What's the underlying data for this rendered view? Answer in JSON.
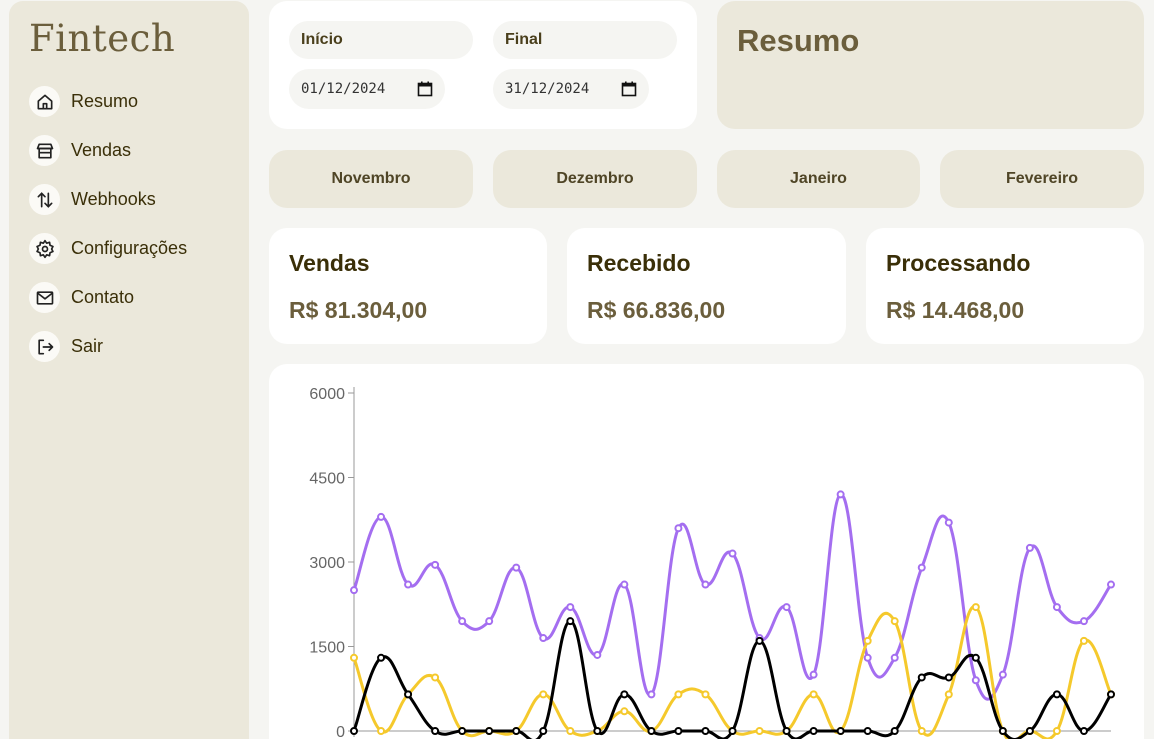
{
  "brand": {
    "name": "Fintech"
  },
  "sidebar": {
    "items": [
      {
        "label": "Resumo",
        "icon": "home-icon"
      },
      {
        "label": "Vendas",
        "icon": "store-icon"
      },
      {
        "label": "Webhooks",
        "icon": "arrows-updown-icon"
      },
      {
        "label": "Configurações",
        "icon": "gear-icon"
      },
      {
        "label": "Contato",
        "icon": "mail-icon"
      },
      {
        "label": "Sair",
        "icon": "logout-icon"
      }
    ]
  },
  "date_filter": {
    "start_label": "Início",
    "start_value": "01/12/2024",
    "end_label": "Final",
    "end_value": "31/12/2024"
  },
  "summary": {
    "title": "Resumo"
  },
  "months": [
    "Novembro",
    "Dezembro",
    "Janeiro",
    "Fevereiro"
  ],
  "stats": [
    {
      "title": "Vendas",
      "value": "R$ 81.304,00"
    },
    {
      "title": "Recebido",
      "value": "R$ 66.836,00"
    },
    {
      "title": "Processando",
      "value": "R$ 14.468,00"
    }
  ],
  "colors": {
    "accent": "#6b5e3c",
    "panel": "#ebe8db",
    "series_purple": "#a46ef0",
    "series_yellow": "#f5c92c",
    "series_black": "#000000"
  },
  "chart_data": {
    "type": "line",
    "ylim": [
      0,
      6000
    ],
    "yticks": [
      0,
      1500,
      3000,
      4500,
      6000
    ],
    "ytick_labels": [
      "0",
      "1500",
      "3000",
      "4500",
      "6000"
    ],
    "series": [
      {
        "color": "#a46ef0",
        "values": [
          2500,
          3800,
          2600,
          2950,
          1950,
          1950,
          2900,
          1650,
          2200,
          1350,
          2600,
          650,
          3600,
          2600,
          3150,
          1650,
          2200,
          1000,
          4200,
          1300,
          1300,
          2900,
          3700,
          900,
          1000,
          3250,
          2200,
          1950,
          2600
        ]
      },
      {
        "color": "#f5c92c",
        "values": [
          1300,
          0,
          650,
          950,
          0,
          0,
          0,
          650,
          0,
          0,
          350,
          0,
          650,
          650,
          0,
          0,
          0,
          650,
          0,
          1600,
          1950,
          0,
          650,
          2200,
          0,
          0,
          0,
          1600,
          650
        ]
      },
      {
        "color": "#000000",
        "values": [
          0,
          1300,
          650,
          0,
          0,
          0,
          0,
          0,
          1950,
          0,
          650,
          0,
          0,
          0,
          0,
          1600,
          0,
          0,
          0,
          0,
          0,
          950,
          950,
          1300,
          0,
          0,
          650,
          0,
          650
        ]
      }
    ]
  }
}
